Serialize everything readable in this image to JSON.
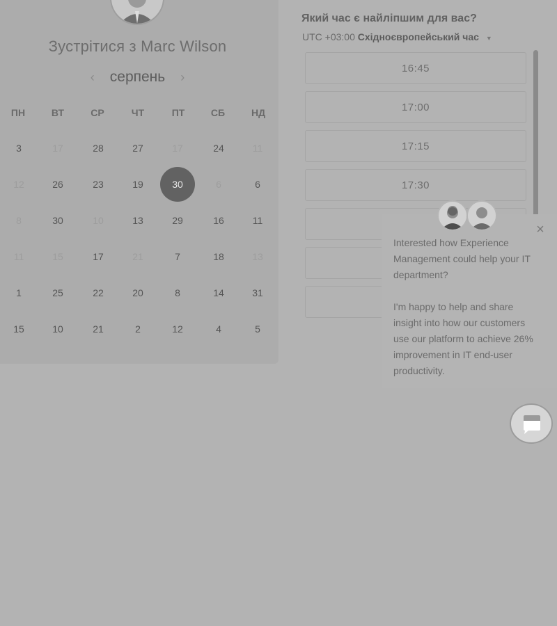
{
  "left": {
    "title": "Зустрітися з Marc Wilson",
    "month": "серпень",
    "weekdays": [
      "ПН",
      "ВТ",
      "СР",
      "ЧТ",
      "ПТ",
      "СБ",
      "НД"
    ],
    "weeks": [
      [
        {
          "d": "3",
          "m": false
        },
        {
          "d": "17",
          "m": true
        },
        {
          "d": "28",
          "m": false
        },
        {
          "d": "27",
          "m": false
        },
        {
          "d": "17",
          "m": true
        },
        {
          "d": "24",
          "m": false
        },
        {
          "d": "11",
          "m": true
        }
      ],
      [
        {
          "d": "12",
          "m": true
        },
        {
          "d": "26",
          "m": false
        },
        {
          "d": "23",
          "m": false
        },
        {
          "d": "19",
          "m": false
        },
        {
          "d": "30",
          "m": false,
          "selected": true
        },
        {
          "d": "6",
          "m": true
        },
        {
          "d": "6",
          "m": false
        }
      ],
      [
        {
          "d": "8",
          "m": true
        },
        {
          "d": "30",
          "m": false
        },
        {
          "d": "10",
          "m": true
        },
        {
          "d": "13",
          "m": false
        },
        {
          "d": "29",
          "m": false
        },
        {
          "d": "16",
          "m": false
        },
        {
          "d": "11",
          "m": false
        }
      ],
      [
        {
          "d": "11",
          "m": true
        },
        {
          "d": "15",
          "m": true
        },
        {
          "d": "17",
          "m": false
        },
        {
          "d": "21",
          "m": true
        },
        {
          "d": "7",
          "m": false
        },
        {
          "d": "18",
          "m": false
        },
        {
          "d": "13",
          "m": true
        }
      ],
      [
        {
          "d": "1",
          "m": false
        },
        {
          "d": "25",
          "m": false
        },
        {
          "d": "22",
          "m": false
        },
        {
          "d": "20",
          "m": false
        },
        {
          "d": "8",
          "m": false
        },
        {
          "d": "14",
          "m": false
        },
        {
          "d": "31",
          "m": false
        }
      ],
      [
        {
          "d": "15",
          "m": false
        },
        {
          "d": "10",
          "m": false
        },
        {
          "d": "21",
          "m": false
        },
        {
          "d": "2",
          "m": false
        },
        {
          "d": "12",
          "m": false
        },
        {
          "d": "4",
          "m": false
        },
        {
          "d": "5",
          "m": false
        }
      ]
    ]
  },
  "right": {
    "question": "Який час є найліпшим для вас?",
    "tz_prefix": "UTC +03:00",
    "tz_name": "Східноєвропейський час",
    "slots": [
      "16:45",
      "17:00",
      "17:15",
      "17:30",
      "",
      "",
      ""
    ]
  },
  "chat": {
    "message1": "Interested how Experience Management could help your IT department?",
    "message2": "I'm happy to help and share insight into how our customers use our platform to achieve 26% improvement in IT end-user productivity."
  },
  "icons": {
    "prev": "chevron-left-icon",
    "next": "chevron-right-icon",
    "close": "close-icon",
    "chat": "chat-bubble-icon"
  },
  "colors": {
    "selected_day": "#626262",
    "background": "#b3b3b3",
    "panel": "#acacac"
  }
}
